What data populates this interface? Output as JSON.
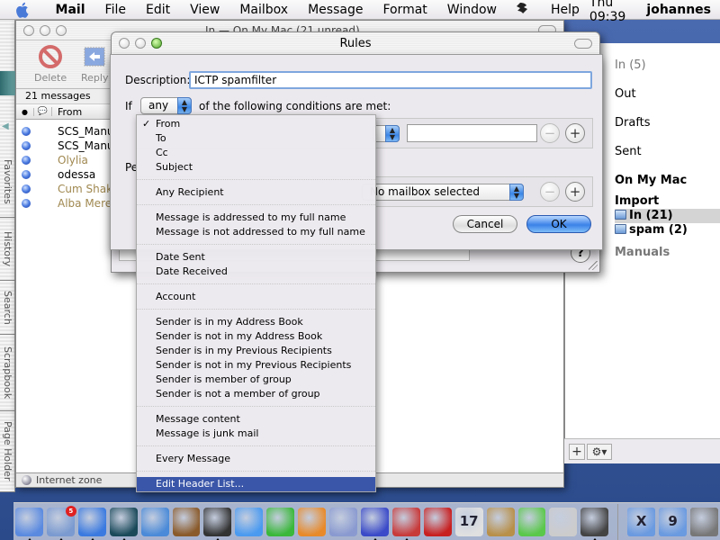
{
  "menubar": {
    "app_name": "Mail",
    "items": [
      "File",
      "Edit",
      "View",
      "Mailbox",
      "Message",
      "Format",
      "Window",
      "Help"
    ],
    "clock": "Thu 09:39",
    "user": "johannes"
  },
  "side_tabs": [
    "Favorites",
    "History",
    "Search",
    "Scrapbook",
    "Page Holder"
  ],
  "mail_window": {
    "title": "In — On My Mac (21 unread)",
    "toolbar": {
      "delete_label": "Delete",
      "reply_label": "Reply"
    },
    "message_count": "21 messages",
    "columns": {
      "from": "From"
    },
    "messages": [
      {
        "from": "SCS_Manu",
        "junk": false
      },
      {
        "from": "SCS_Manu",
        "junk": false
      },
      {
        "from": "Olylia",
        "junk": true
      },
      {
        "from": "odessa",
        "junk": false
      },
      {
        "from": "Cum Shak",
        "junk": true
      },
      {
        "from": "Alba Mere",
        "junk": true
      }
    ],
    "status": "Internet zone"
  },
  "drawer": {
    "mailboxes": [
      {
        "label": "In (5)",
        "style": "gray"
      },
      {
        "label": "Out",
        "style": "normal"
      },
      {
        "label": "Drafts",
        "style": "normal"
      },
      {
        "label": "Sent",
        "style": "normal"
      },
      {
        "label": "On My Mac",
        "style": "bold"
      },
      {
        "label": "Import",
        "style": "bold"
      },
      {
        "label": "In (21)",
        "style": "bold",
        "selected": true,
        "folder": true
      },
      {
        "label": "spam (2)",
        "style": "bold",
        "folder": true
      },
      {
        "label": "Manuals",
        "style": "gray-bold"
      }
    ],
    "add_label": "+",
    "action_label": "⚙▾"
  },
  "rules_window": {
    "title": "Rules",
    "help_label": "?"
  },
  "sheet": {
    "description_label": "Description:",
    "description_value": "ICTP spamfilter",
    "if_label": "If",
    "match_value": "any",
    "conditions_text": "of the following conditions are met:",
    "perform_label": "Pe",
    "mailbox_value": "No mailbox selected",
    "cancel_label": "Cancel",
    "ok_label": "OK",
    "minus_label": "−",
    "plus_label": "+"
  },
  "dropdown": {
    "groups": [
      [
        {
          "label": "From",
          "checked": true
        },
        {
          "label": "To"
        },
        {
          "label": "Cc"
        },
        {
          "label": "Subject"
        }
      ],
      [
        {
          "label": "Any Recipient"
        }
      ],
      [
        {
          "label": "Message is addressed to my full name"
        },
        {
          "label": "Message is not addressed to my full name"
        }
      ],
      [
        {
          "label": "Date Sent"
        },
        {
          "label": "Date Received"
        }
      ],
      [
        {
          "label": "Account"
        }
      ],
      [
        {
          "label": "Sender is in my Address Book"
        },
        {
          "label": "Sender is not in my Address Book"
        },
        {
          "label": "Sender is in my Previous Recipients"
        },
        {
          "label": "Sender is not in my Previous Recipients"
        },
        {
          "label": "Sender is member of group"
        },
        {
          "label": "Sender is not a member of group"
        }
      ],
      [
        {
          "label": "Message content"
        },
        {
          "label": "Message is junk mail"
        }
      ],
      [
        {
          "label": "Every Message"
        }
      ],
      [
        {
          "label": "Edit Header List...",
          "highlighted": true
        }
      ]
    ],
    "check_glyph": "✓"
  },
  "dock": {
    "apps": [
      {
        "name": "finder",
        "color": "#5a8ae0",
        "running": true
      },
      {
        "name": "mail",
        "color": "#7a9ad0",
        "running": true,
        "badge": "5"
      },
      {
        "name": "internet-explorer",
        "color": "#3a7ae0",
        "running": true
      },
      {
        "name": "netscape",
        "color": "#1a4a5a",
        "running": true
      },
      {
        "name": "safari",
        "color": "#4a8ad8",
        "running": false
      },
      {
        "name": "x11",
        "color": "#8a5a2a",
        "running": false
      },
      {
        "name": "terminal",
        "color": "#333333",
        "running": true
      },
      {
        "name": "word",
        "color": "#4a9af0",
        "running": false
      },
      {
        "name": "excel",
        "color": "#3ab83a",
        "running": false
      },
      {
        "name": "powerpoint",
        "color": "#e88a2a",
        "running": false
      },
      {
        "name": "migration",
        "color": "#8a9ad0",
        "running": false
      },
      {
        "name": "bbedit",
        "color": "#3a4ac8",
        "running": true
      },
      {
        "name": "network-sharing",
        "color": "#c83a3a",
        "running": true
      },
      {
        "name": "adobe-reader",
        "color": "#c82020",
        "running": false
      },
      {
        "name": "ical",
        "color": "#e0e0e0",
        "running": false,
        "text": "17"
      },
      {
        "name": "address-book",
        "color": "#b8904a",
        "running": false
      },
      {
        "name": "itunes",
        "color": "#5ac84a",
        "running": false
      },
      {
        "name": "system-preferences",
        "color": "#cccccc",
        "running": false
      },
      {
        "name": "printer",
        "color": "#444444",
        "running": true
      }
    ],
    "folders": [
      {
        "name": "applications-x",
        "color": "#6a9ae0",
        "label": "X"
      },
      {
        "name": "os9-folder",
        "color": "#6a9ae0",
        "label": "9"
      },
      {
        "name": "trash",
        "color": "#777777"
      }
    ]
  }
}
